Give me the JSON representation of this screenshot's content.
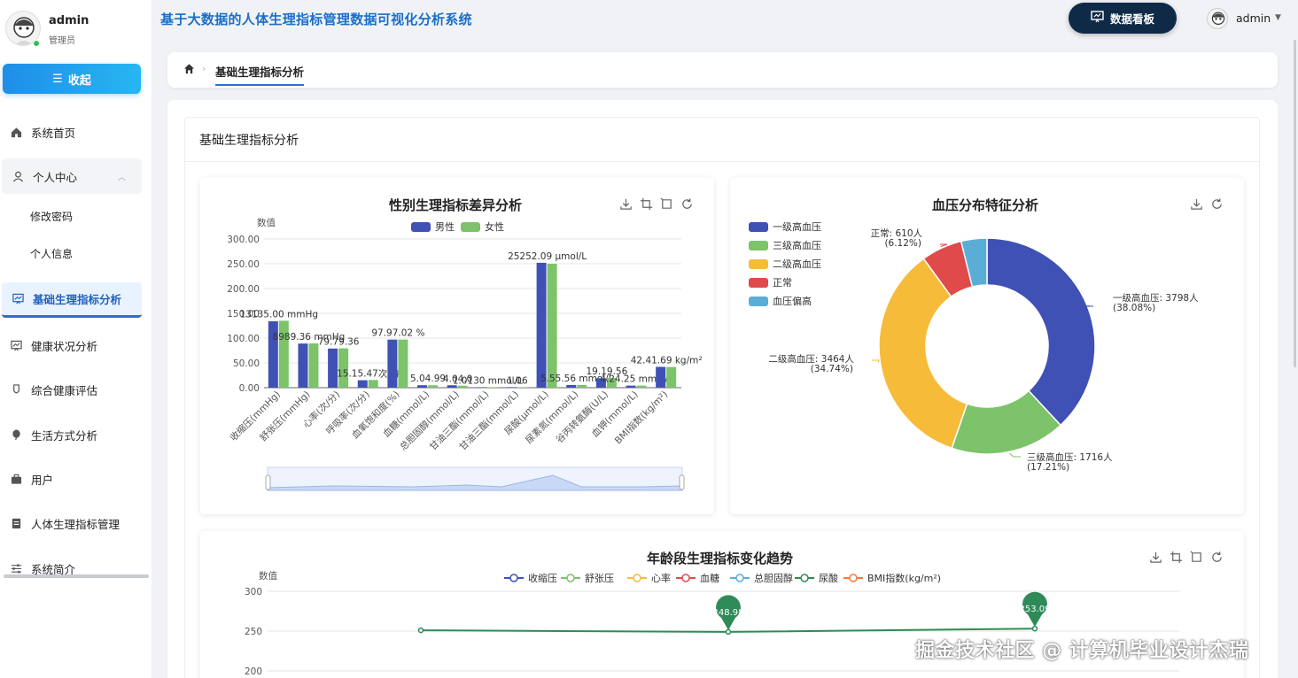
{
  "sidebar": {
    "user": {
      "name": "admin",
      "role": "管理员"
    },
    "collapse_label": "收起",
    "items": [
      {
        "label": "系统首页"
      },
      {
        "label": "个人中心"
      },
      {
        "label": "修改密码"
      },
      {
        "label": "个人信息"
      },
      {
        "label": "基础生理指标分析"
      },
      {
        "label": "健康状况分析"
      },
      {
        "label": "综合健康评估"
      },
      {
        "label": "生活方式分析"
      },
      {
        "label": "用户"
      },
      {
        "label": "人体生理指标管理"
      },
      {
        "label": "系统简介"
      }
    ]
  },
  "header": {
    "title": "基于大数据的人体生理指标管理数据可视化分析系统",
    "dashboard_label": "数据看板",
    "user": "admin"
  },
  "breadcrumb": {
    "current": "基础生理指标分析"
  },
  "page": {
    "card_title": "基础生理指标分析"
  },
  "watermark": "掘金技术社区 @ 计算机毕业设计杰瑞",
  "colors": {
    "male": "#3f51b5",
    "female": "#7cc36a",
    "accent": "#1b6fc8"
  },
  "chart_data": [
    {
      "type": "bar",
      "title": "性别生理指标差异分析",
      "ylabel": "数值",
      "ylim": [
        0,
        300
      ],
      "yticks": [
        "0.00",
        "50.00",
        "100.00",
        "150.00",
        "200.00",
        "250.00",
        "300.00"
      ],
      "categories": [
        "收缩压(mmHg)",
        "舒张压(mmHg)",
        "心率(次/分)",
        "呼吸率(次/分)",
        "血氧饱和度(%)",
        "血糖(mmol/L)",
        "总胆固醇(mmol/L)",
        "甘油三酯(mmol/L)",
        "甘油三酯(mmol/L)",
        "尿酸(μmol/L)",
        "尿素氮(mmol/L)",
        "谷丙转氨酶(U/L)",
        "血钾(mmol/L)",
        "BMI指数(kg/m²)"
      ],
      "series": [
        {
          "name": "男性",
          "color": "#3f51b5",
          "values": [
            134,
            89,
            79,
            15,
            97,
            5.0,
            4.9,
            1.0,
            1.1,
            252,
            5.5,
            19,
            4.2,
            42
          ]
        },
        {
          "name": "女性",
          "color": "#7cc36a",
          "values": [
            135,
            89.36,
            79.36,
            15.47,
            97.02,
            4.9,
            4.0,
            1.0,
            1.06,
            250,
            5.56,
            19.56,
            4.25,
            41.69
          ]
        }
      ],
      "annotations": [
        "13135.00 mmHg",
        "8989.36 mmHg",
        "79.79.36",
        "15.15.47次/分",
        "97.97.02 %",
        "5.04.99",
        "4.04.0",
        "1.0130 mmol/L",
        "1.06",
        "25252.09 μmol/L",
        "5.55.56 mmol/L",
        "19.19.56",
        "4.24.25 mmol/L",
        "42.41.69 kg/m²"
      ]
    },
    {
      "type": "pie",
      "title": "血压分布特征分析",
      "slices": [
        {
          "name": "一级高血压",
          "value": 3798,
          "label": "一级高血压: 3798人",
          "pct": "(38.08%)",
          "color": "#3f51b5"
        },
        {
          "name": "三级高血压",
          "value": 1716,
          "label": "三级高血压: 1716人",
          "pct": "(17.21%)",
          "color": "#7cc36a"
        },
        {
          "name": "二级高血压",
          "value": 3464,
          "label": "二级高血压: 3464人",
          "pct": "(34.74%)",
          "color": "#f7bb3a"
        },
        {
          "name": "正常",
          "value": 610,
          "label": "正常: 610人",
          "pct": "(6.12%)",
          "color": "#e04a4a"
        },
        {
          "name": "血压偏高",
          "value": 385,
          "label": "",
          "pct": "",
          "color": "#5aaed6"
        }
      ]
    },
    {
      "type": "line",
      "title": "年龄段生理指标变化趋势",
      "ylabel": "数值",
      "yticks": [
        "300",
        "250",
        "200"
      ],
      "legend": [
        {
          "name": "收缩压",
          "color": "#3f51b5"
        },
        {
          "name": "舒张压",
          "color": "#7cc36a"
        },
        {
          "name": "心率",
          "color": "#f7bb3a"
        },
        {
          "name": "血糖",
          "color": "#e04a4a"
        },
        {
          "name": "总胆固醇",
          "color": "#5aaed6"
        },
        {
          "name": "尿酸",
          "color": "#2e8b57"
        },
        {
          "name": "BMI指数(kg/m²)",
          "color": "#f07b3f"
        }
      ],
      "series": [
        {
          "name": "尿酸",
          "values": [
            251,
            248.98,
            253.09
          ]
        }
      ],
      "markers": [
        "248.98",
        "253.09"
      ]
    }
  ]
}
